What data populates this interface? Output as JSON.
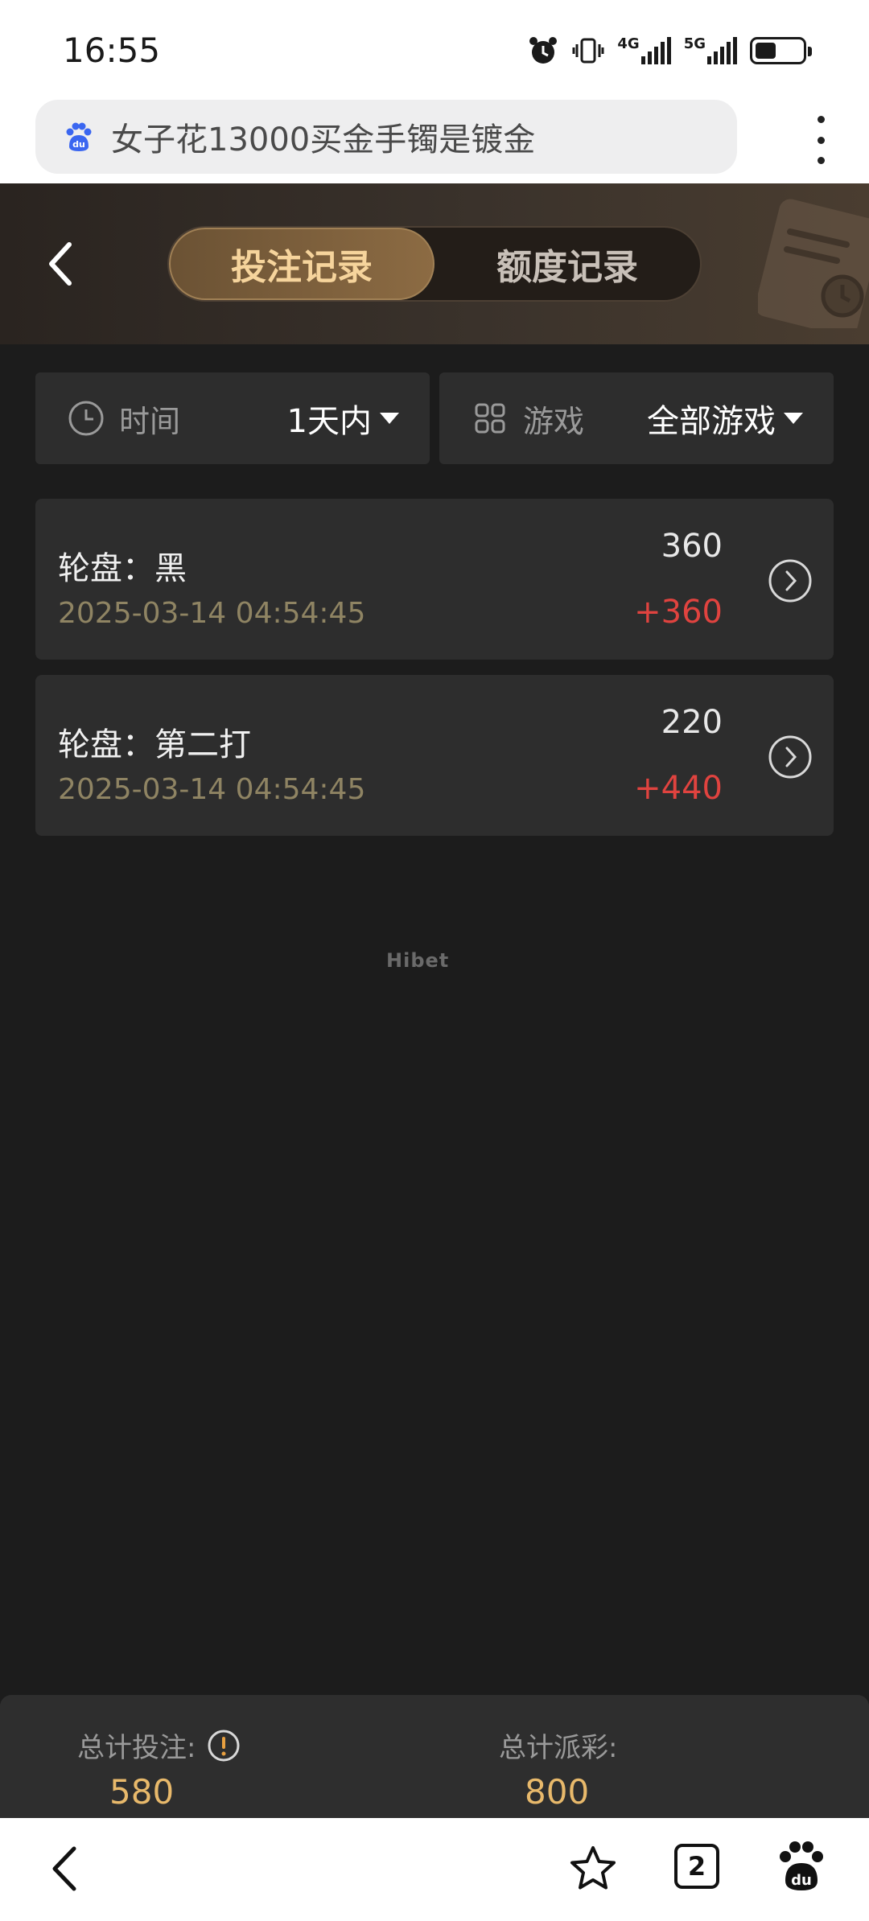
{
  "status_bar": {
    "time": "16:55",
    "network_1": "4G",
    "network_2": "5G",
    "battery_level": 0.45,
    "icons": [
      "alarm-icon",
      "vibrate-icon",
      "signal-icon",
      "battery-icon"
    ]
  },
  "browser": {
    "url_text": "女子花13000买金手镯是镀金",
    "tab_count": "2"
  },
  "header": {
    "tabs": [
      {
        "label": "投注记录",
        "active": true
      },
      {
        "label": "额度记录",
        "active": false
      }
    ]
  },
  "filters": {
    "time": {
      "label": "时间",
      "value": "1天内"
    },
    "game": {
      "label": "游戏",
      "value": "全部游戏"
    }
  },
  "records": [
    {
      "title": "轮盘：黑",
      "time": "2025-03-14 04:54:45",
      "bet": "360",
      "payout": "+360"
    },
    {
      "title": "轮盘：第二打",
      "time": "2025-03-14 04:54:45",
      "bet": "220",
      "payout": "+440"
    }
  ],
  "watermark": "Hibet",
  "summary": {
    "total_bet_label": "总计投注:",
    "total_bet_value": "580",
    "total_payout_label": "总计派彩:",
    "total_payout_value": "800"
  },
  "colors": {
    "background": "#1c1c1c",
    "card": "#2d2d2d",
    "accent_gold": "#e8b96b",
    "win_red": "#e0433f"
  }
}
